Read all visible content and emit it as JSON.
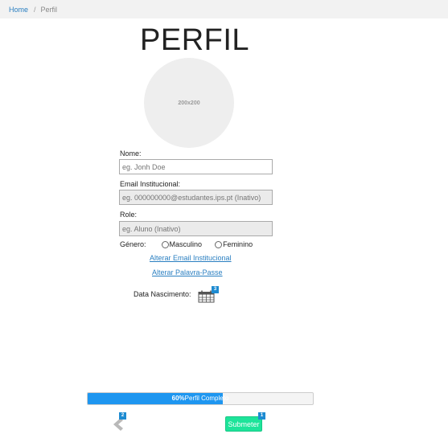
{
  "breadcrumb": {
    "home": "Home",
    "separator": "/",
    "current": "Perfil"
  },
  "page_title": "PERFIL",
  "avatar": {
    "placeholder_text": "200x200"
  },
  "form": {
    "name": {
      "label": "Nome:",
      "placeholder": "eg. Jonh Doe",
      "value": ""
    },
    "email": {
      "label": "Email Institucional:",
      "placeholder": "eg. 000000000@estudantes.ips.pt (Inativo)"
    },
    "role": {
      "label": "Role:",
      "placeholder": "eg. Aluno (Inativo)"
    },
    "gender": {
      "label": "Género:",
      "options": [
        "Masculino",
        "Feminino"
      ]
    },
    "change_email_link": "Alterar Email Institucional",
    "change_password_link": "Alterar Palavra-Passe",
    "birth_date": {
      "label": "Data Nascimento:",
      "icon": "calendar-icon",
      "badge": "3"
    }
  },
  "progress": {
    "percent_text": "60%",
    "percent_value": 60,
    "label": "Perfil Completo",
    "color": "#1e96f0"
  },
  "actions": {
    "back": {
      "icon": "chevron-left-icon",
      "badge": "2"
    },
    "submit": {
      "label": "Submeter",
      "badge": "1",
      "color": "#1de49a"
    }
  },
  "colors": {
    "badge": "#1e8bd1",
    "link": "#2a7fc1"
  }
}
